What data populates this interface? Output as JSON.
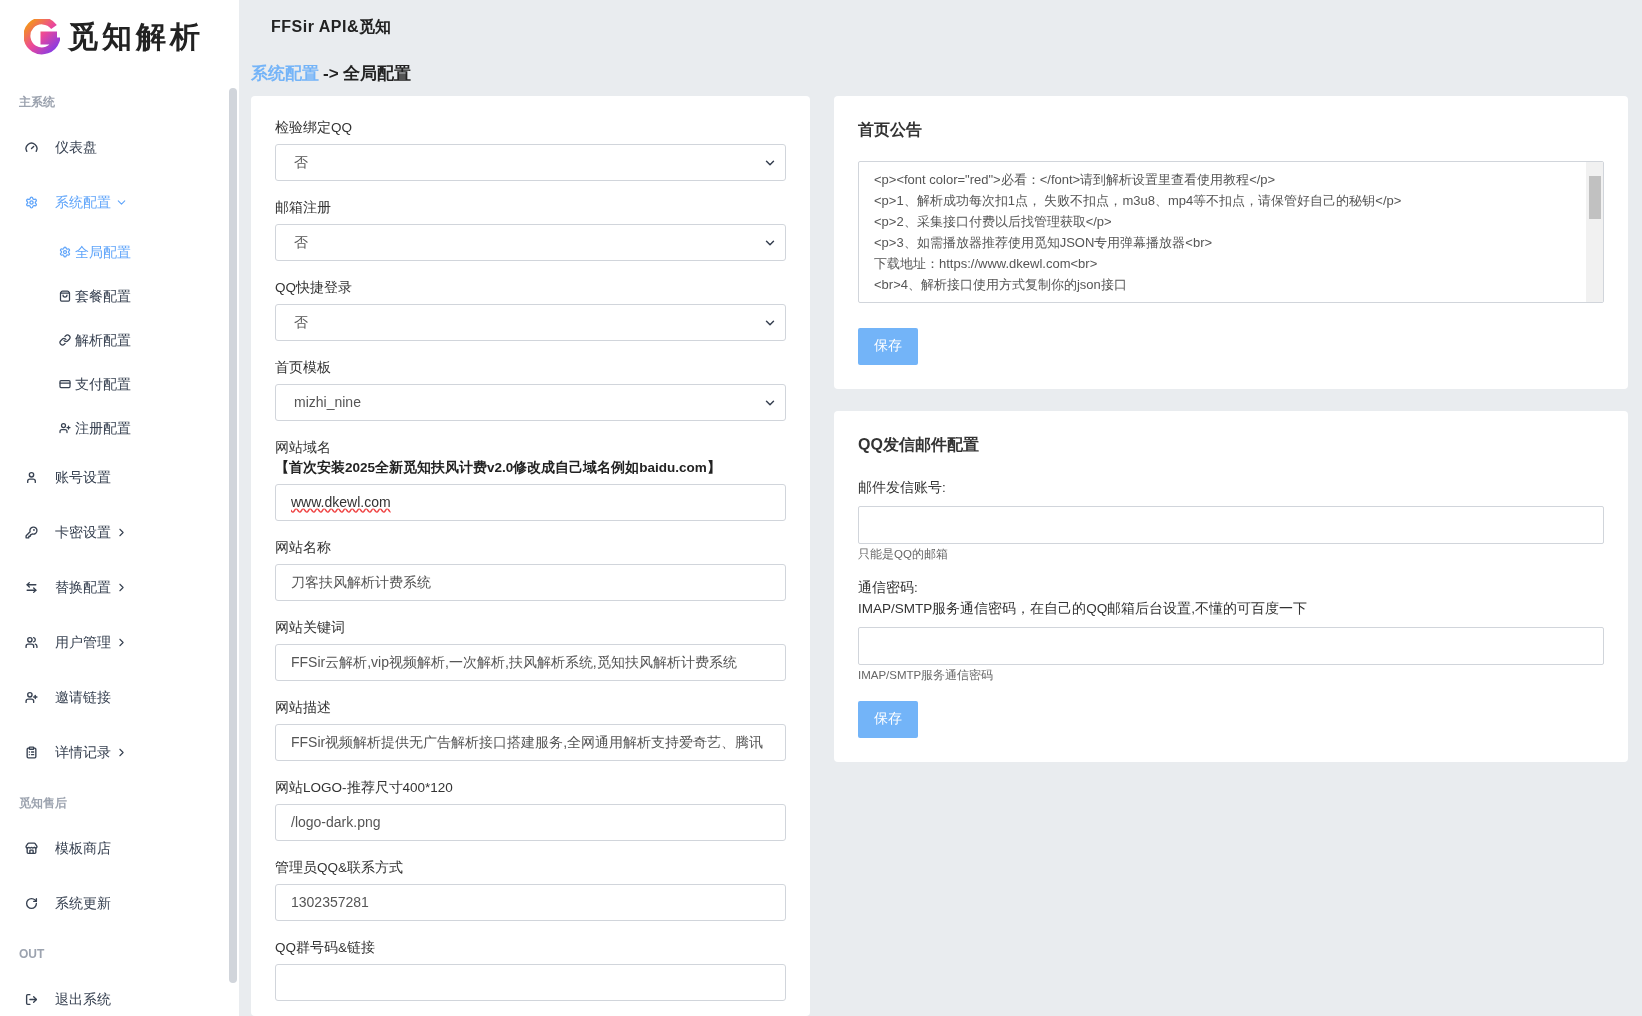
{
  "sidebar": {
    "logo_text": "觅知解析",
    "sections": [
      {
        "title": "主系统",
        "items": [
          {
            "label": "仪表盘",
            "selected": false
          },
          {
            "label": "系统配置",
            "selected": true,
            "expanded": true,
            "children": [
              {
                "label": "全局配置",
                "selected": true
              },
              {
                "label": "套餐配置",
                "selected": false
              },
              {
                "label": "解析配置",
                "selected": false
              },
              {
                "label": "支付配置",
                "selected": false
              },
              {
                "label": "注册配置",
                "selected": false
              }
            ]
          },
          {
            "label": "账号设置",
            "selected": false
          },
          {
            "label": "卡密设置",
            "selected": false,
            "expanded": false
          },
          {
            "label": "替换配置",
            "selected": false,
            "expanded": false
          },
          {
            "label": "用户管理",
            "selected": false,
            "expanded": false
          },
          {
            "label": "邀请链接",
            "selected": false
          },
          {
            "label": "详情记录",
            "selected": false,
            "expanded": false
          }
        ]
      },
      {
        "title": "觅知售后",
        "items": [
          {
            "label": "模板商店",
            "selected": false
          },
          {
            "label": "系统更新",
            "selected": false
          }
        ]
      },
      {
        "title": "OUT",
        "items": [
          {
            "label": "退出系统",
            "selected": false
          }
        ]
      }
    ]
  },
  "header": {
    "title": "FFSir API&觅知"
  },
  "breadcrumb": {
    "parent": "系统配置",
    "separator": "->",
    "current": "全局配置"
  },
  "global_form": {
    "fields": [
      {
        "kind": "select",
        "label": "检验绑定QQ",
        "value": "否"
      },
      {
        "kind": "select",
        "label": "邮箱注册",
        "value": "否"
      },
      {
        "kind": "select",
        "label": "QQ快捷登录",
        "value": "否"
      },
      {
        "kind": "select",
        "label": "首页模板",
        "value": "mizhi_nine"
      },
      {
        "kind": "input",
        "label": "网站域名",
        "note": "【首次安装2025全新觅知扶风计费v2.0修改成自己域名例如baidu.com】",
        "value": "www.dkewl.com",
        "spellcheck_error": true
      },
      {
        "kind": "input",
        "label": "网站名称",
        "value": "刀客扶风解析计费系统"
      },
      {
        "kind": "input",
        "label": "网站关键词",
        "value": "FFSir云解析,vip视频解析,一次解析,扶风解析系统,觅知扶风解析计费系统"
      },
      {
        "kind": "input",
        "label": "网站描述",
        "value": "FFSir视频解析提供无广告解析接口搭建服务,全网通用解析支持爱奇艺、腾讯"
      },
      {
        "kind": "input",
        "label": "网站LOGO-推荐尺寸400*120",
        "value": "/logo-dark.png"
      },
      {
        "kind": "input",
        "label": "管理员QQ&联系方式",
        "value": "1302357281"
      },
      {
        "kind": "input",
        "label": "QQ群号码&链接"
      }
    ]
  },
  "notice_card": {
    "title": "首页公告",
    "textarea_lines": [
      "<p><font color=\"red\">必看：</font>请到解析设置里查看使用教程</p>",
      "<p>1、解析成功每次扣1点， 失败不扣点，m3u8、mp4等不扣点，请保管好自己的秘钥</p>",
      "<p>2、采集接口付费以后找管理获取</p>",
      "<p>3、如需播放器推荐使用觅知JSON专用弹幕播放器<br>",
      "下载地址：https://www.dkewl.com<br>",
      "<br>4、解析接口使用方式复制你的json接口"
    ],
    "button": "保存"
  },
  "mail_card": {
    "title": "QQ发信邮件配置",
    "fields": [
      {
        "label": "邮件发信账号:",
        "help": "只能是QQ的邮箱"
      },
      {
        "label": "通信密码:",
        "note": "IMAP/SMTP服务通信密码，在自己的QQ邮箱后台设置,不懂的可百度一下",
        "help": "IMAP/SMTP服务通信密码"
      }
    ],
    "button": "保存"
  }
}
